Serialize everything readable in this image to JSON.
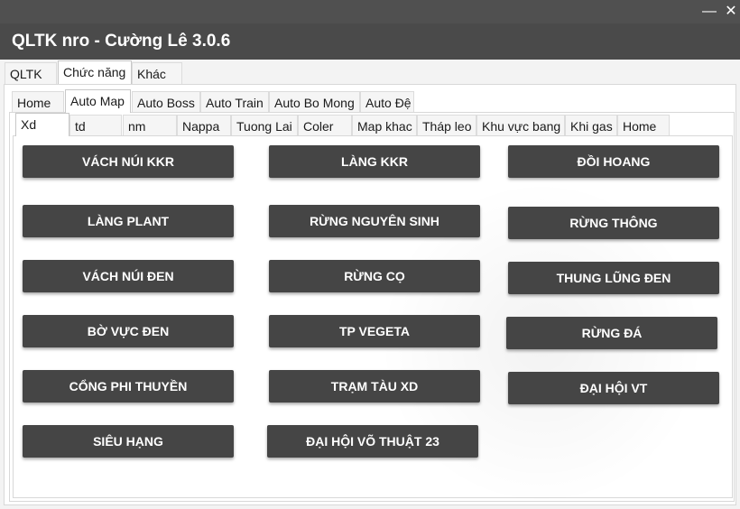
{
  "window": {
    "title": "QLTK nro - Cường Lê  3.0.6",
    "minimize": "—",
    "close": "✕"
  },
  "main_tabs": [
    "QLTK",
    "Chức năng",
    "Khác"
  ],
  "sub_tabs": [
    "Home",
    "Auto Map",
    "Auto Boss",
    "Auto Train",
    "Auto Bo Mong",
    "Auto Đệ"
  ],
  "map_tabs": [
    "Xd",
    "td",
    "nm",
    "Nappa",
    "Tuong Lai",
    "Coler",
    "Map khac",
    "Tháp leo",
    "Khu vực bang",
    "Khi gas",
    "Home"
  ],
  "buttons": {
    "col1": [
      "VÁCH NÚI KKR",
      "LÀNG PLANT",
      "VÁCH NÚI ĐEN",
      "BỜ VỰC ĐEN",
      "CỔNG PHI THUYỀN",
      "SIÊU HẠNG"
    ],
    "col2": [
      "LÀNG KKR",
      "RỪNG NGUYÊN SINH",
      "RỪNG CỌ",
      "TP VEGETA",
      "TRẠM TÀU XD",
      "ĐẠI HỘI VÕ THUẬT 23"
    ],
    "col3": [
      "ĐỒI HOANG",
      "RỪNG THÔNG",
      "THUNG LŨNG ĐEN",
      "RỪNG ĐÁ",
      "ĐẠI HỘI VT"
    ]
  }
}
